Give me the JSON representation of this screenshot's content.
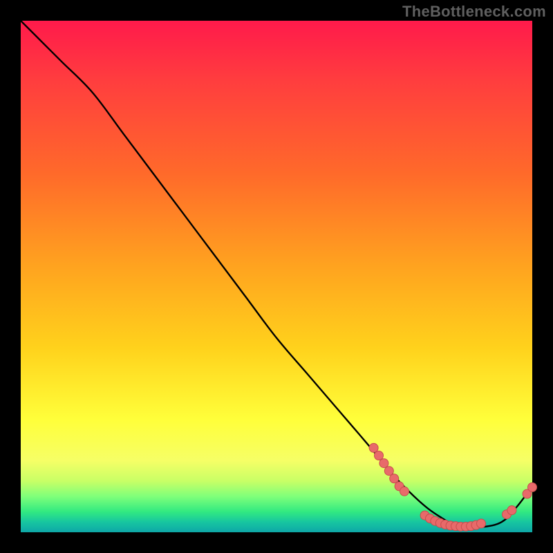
{
  "watermark": "TheBottleneck.com",
  "colors": {
    "background": "#000000",
    "watermark_text": "#5f5f5f",
    "curve": "#000000",
    "dot_fill": "#e86a6a",
    "dot_stroke": "#c74d4d"
  },
  "chart_data": {
    "type": "line",
    "title": "",
    "xlabel": "",
    "ylabel": "",
    "xlim": [
      0,
      100
    ],
    "ylim": [
      0,
      100
    ],
    "series": [
      {
        "name": "bottleneck-curve",
        "x": [
          0,
          4,
          8,
          14,
          20,
          26,
          32,
          38,
          44,
          50,
          56,
          62,
          68,
          73,
          78,
          82,
          86,
          90,
          94,
          97,
          100
        ],
        "y": [
          100,
          96,
          92,
          86,
          78,
          70,
          62,
          54,
          46,
          38,
          31,
          24,
          17,
          11,
          6,
          3,
          1,
          1,
          2,
          5,
          9
        ]
      }
    ],
    "dot_clusters": [
      {
        "name": "descent-cluster",
        "points": [
          [
            69,
            16.5
          ],
          [
            70,
            15
          ],
          [
            71,
            13.5
          ],
          [
            72,
            12
          ],
          [
            73,
            10.5
          ],
          [
            74,
            9
          ],
          [
            75,
            8
          ]
        ]
      },
      {
        "name": "valley-cluster",
        "points": [
          [
            79,
            3.3
          ],
          [
            80,
            2.7
          ],
          [
            81,
            2.2
          ],
          [
            82,
            1.8
          ],
          [
            83,
            1.5
          ],
          [
            84,
            1.3
          ],
          [
            85,
            1.2
          ],
          [
            86,
            1.1
          ],
          [
            87,
            1.1
          ],
          [
            88,
            1.2
          ],
          [
            89,
            1.4
          ],
          [
            90,
            1.7
          ]
        ]
      },
      {
        "name": "rise-cluster",
        "points": [
          [
            95,
            3.5
          ],
          [
            96,
            4.3
          ],
          [
            99,
            7.5
          ],
          [
            100,
            8.8
          ]
        ]
      }
    ]
  }
}
